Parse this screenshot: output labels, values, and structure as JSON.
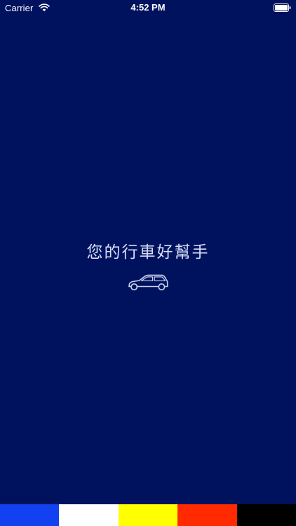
{
  "status_bar": {
    "carrier": "Carrier",
    "time": "4:52 PM",
    "wifi_icon": "wifi-icon",
    "battery_icon": "battery-icon"
  },
  "splash": {
    "tagline": "您的行車好幫手",
    "car_icon": "car-icon",
    "background_color": "#00125e"
  },
  "color_stripe": {
    "colors": [
      "#1241f2",
      "#ffffff",
      "#ffff00",
      "#ff2a00",
      "#000000"
    ]
  }
}
